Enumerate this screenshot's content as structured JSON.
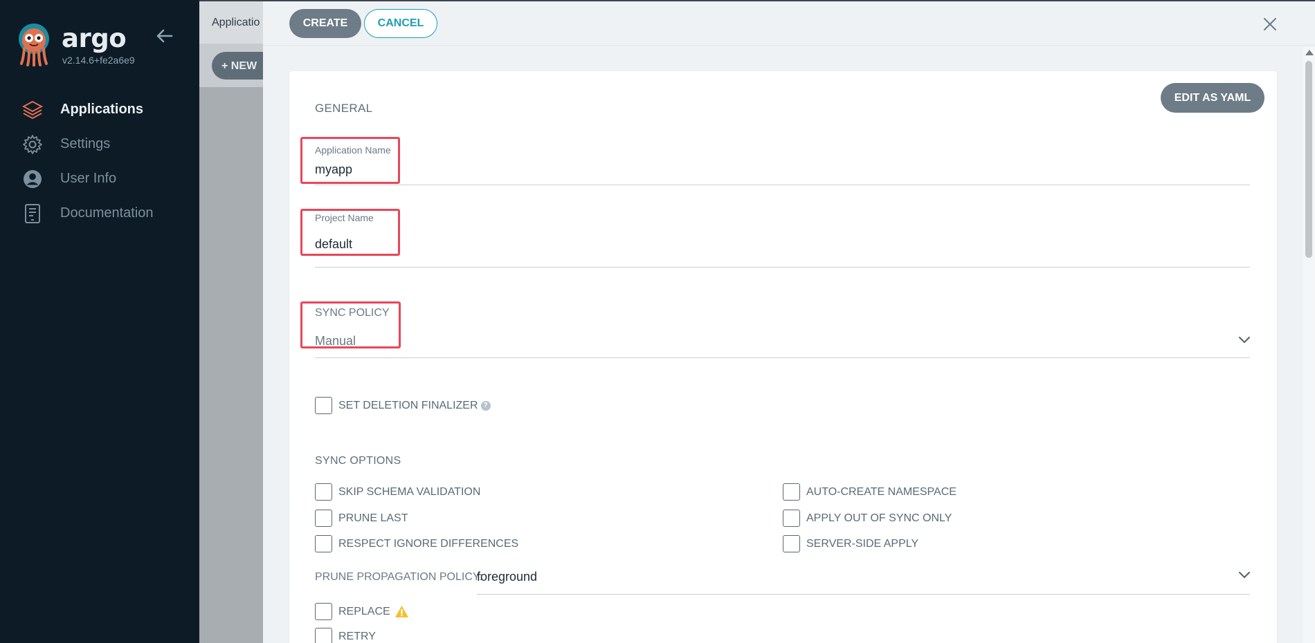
{
  "sidebar": {
    "brand": "argo",
    "version": "v2.14.6+fe2a6e9",
    "items": [
      {
        "label": "Applications",
        "icon": "layers-icon",
        "active": true
      },
      {
        "label": "Settings",
        "icon": "gear-icon",
        "active": false
      },
      {
        "label": "User Info",
        "icon": "user-icon",
        "active": false
      },
      {
        "label": "Documentation",
        "icon": "book-icon",
        "active": false
      }
    ]
  },
  "background": {
    "page_title": "Applicatio",
    "new_button": "+ NEW"
  },
  "panel": {
    "create_label": "CREATE",
    "cancel_label": "CANCEL",
    "edit_yaml_label": "EDIT AS YAML",
    "general": {
      "title": "GENERAL",
      "app_name_label": "Application Name",
      "app_name_value": "myapp",
      "project_label": "Project Name",
      "project_value": "default",
      "sync_policy_label": "SYNC POLICY",
      "sync_policy_value": "Manual",
      "deletion_finalizer_label": "SET DELETION FINALIZER"
    },
    "sync_options": {
      "title": "SYNC OPTIONS",
      "left": [
        "SKIP SCHEMA VALIDATION",
        "PRUNE LAST",
        "RESPECT IGNORE DIFFERENCES"
      ],
      "right": [
        "AUTO-CREATE NAMESPACE",
        "APPLY OUT OF SYNC ONLY",
        "SERVER-SIDE APPLY"
      ],
      "prune_policy_label": "PRUNE PROPAGATION POLICY:",
      "prune_policy_value": "foreground",
      "replace_label": "REPLACE",
      "retry_label": "RETRY"
    }
  },
  "colors": {
    "sidebar_bg": "#0d1b26",
    "primary_button": "#6d7c87",
    "accent_teal": "#1d9eb3",
    "highlight_red": "#e8465b",
    "warning": "#f4c030"
  }
}
